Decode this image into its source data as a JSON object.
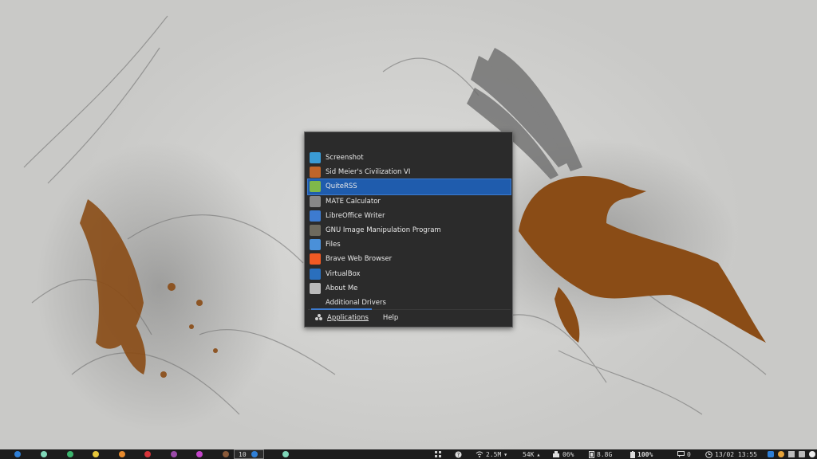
{
  "menu": {
    "items": [
      {
        "label": "Screenshot",
        "icon": "screenshot-icon",
        "color": "#3a9bd5",
        "selected": false
      },
      {
        "label": "Sid Meier's Civilization VI",
        "icon": "civilization-icon",
        "color": "#c0652a",
        "selected": false
      },
      {
        "label": "QuiteRSS",
        "icon": "rss-icon",
        "color": "#7fb84a",
        "selected": true
      },
      {
        "label": "MATE Calculator",
        "icon": "calculator-icon",
        "color": "#888888",
        "selected": false
      },
      {
        "label": "LibreOffice Writer",
        "icon": "writer-icon",
        "color": "#3d7bd0",
        "selected": false
      },
      {
        "label": "GNU Image Manipulation Program",
        "icon": "gimp-icon",
        "color": "#6e6a5e",
        "selected": false
      },
      {
        "label": "Files",
        "icon": "files-icon",
        "color": "#4a90d9",
        "selected": false
      },
      {
        "label": "Brave Web Browser",
        "icon": "brave-icon",
        "color": "#f15a24",
        "selected": false
      },
      {
        "label": "VirtualBox",
        "icon": "virtualbox-icon",
        "color": "#2a6fbd",
        "selected": false
      },
      {
        "label": "About Me",
        "icon": "about-me-icon",
        "color": "#bbbbbb",
        "selected": false
      },
      {
        "label": "Additional Drivers",
        "icon": "drivers-icon",
        "color": "#2b2b2b",
        "selected": false
      }
    ],
    "applications_label": "Applications",
    "help_label": "Help"
  },
  "taskbar": {
    "workspace_colors": [
      "#2f7fd6",
      "#7fd6b8",
      "#3cb46e",
      "#e6c63a",
      "#e68a2e",
      "#d6343a",
      "#9a4aa8",
      "#c244c9",
      "#8a5a3a"
    ],
    "current_workspace": "10",
    "extra_workspace_color": "#7fd6b8",
    "network_rate": "2.5M",
    "upload_rate": "54K",
    "cpu": "06%",
    "memory": "8.8G",
    "battery": "100%",
    "notifications": "0",
    "clock": "13/02 13:55"
  }
}
